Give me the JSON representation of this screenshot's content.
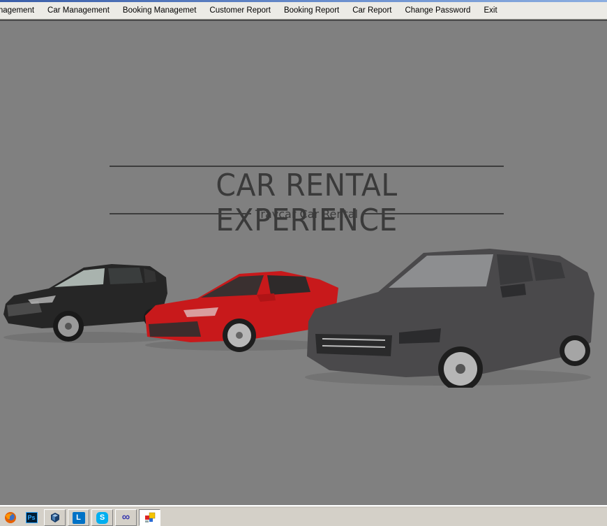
{
  "menubar": {
    "items": [
      {
        "label": "anagement"
      },
      {
        "label": "Car Management"
      },
      {
        "label": "Booking Managemet"
      },
      {
        "label": "Customer Report"
      },
      {
        "label": "Booking Report"
      },
      {
        "label": "Car Report"
      },
      {
        "label": "Change Password"
      },
      {
        "label": "Exit"
      }
    ]
  },
  "banner": {
    "title": "CAR RENTAL EXPERIENCE",
    "subtitle": "Travcar Car Rental"
  },
  "cars": [
    {
      "name": "black-suv",
      "color": "#2b2b2b"
    },
    {
      "name": "red-sedan",
      "color": "#c8191b"
    },
    {
      "name": "grey-sedan",
      "color": "#4a494b"
    }
  ],
  "taskbar": {
    "apps": [
      {
        "name": "firefox",
        "label": "Firefox"
      },
      {
        "name": "photoshop",
        "label": "Ps"
      },
      {
        "name": "virtualbox",
        "label": "VirtualBox"
      },
      {
        "name": "lync",
        "label": "L"
      },
      {
        "name": "skype",
        "label": "S"
      },
      {
        "name": "infinity",
        "label": "∞"
      },
      {
        "name": "car-rental-app",
        "label": "App"
      }
    ]
  }
}
